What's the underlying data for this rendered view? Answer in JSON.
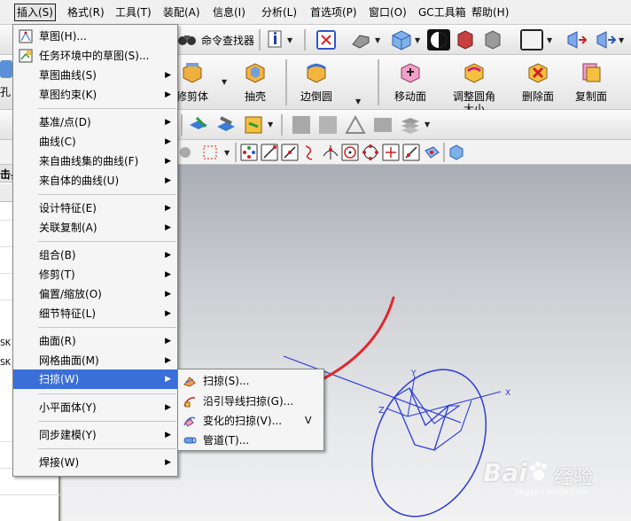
{
  "menubar": {
    "items": [
      {
        "label": "插入(S)",
        "active": true
      },
      {
        "label": "格式(R)"
      },
      {
        "label": "工具(T)"
      },
      {
        "label": "装配(A)"
      },
      {
        "label": "信息(I)"
      },
      {
        "label": "分析(L)"
      },
      {
        "label": "首选项(P)"
      },
      {
        "label": "窗口(O)"
      },
      {
        "label": "GC工具箱"
      },
      {
        "label": "帮助(H)"
      }
    ]
  },
  "toolbar": {
    "command_finder": "命令查找器",
    "left_cut_label": "孔",
    "buttons": [
      {
        "label": "修剪体"
      },
      {
        "label": "抽壳"
      },
      {
        "label": "边倒圆"
      },
      {
        "label": "移动面"
      },
      {
        "label": "调整圆角",
        "label2": "大小"
      },
      {
        "label": "删除面"
      },
      {
        "label": "复制面"
      }
    ]
  },
  "left_panel": {
    "header_cut": "击县",
    "row1": "SK",
    "row2": "SK"
  },
  "insert_menu": {
    "items": [
      {
        "label": "草图(H)...",
        "arrow": ""
      },
      {
        "label": "任务环境中的草图(S)...",
        "arrow": ""
      },
      {
        "label": "草图曲线(S)",
        "arrow": "▶"
      },
      {
        "label": "草图约束(K)",
        "arrow": "▶"
      },
      {
        "label": "基准/点(D)",
        "arrow": "▶"
      },
      {
        "label": "曲线(C)",
        "arrow": "▶"
      },
      {
        "label": "来自曲线集的曲线(F)",
        "arrow": "▶"
      },
      {
        "label": "来自体的曲线(U)",
        "arrow": "▶"
      },
      {
        "label": "设计特征(E)",
        "arrow": "▶"
      },
      {
        "label": "关联复制(A)",
        "arrow": "▶"
      },
      {
        "label": "组合(B)",
        "arrow": "▶"
      },
      {
        "label": "修剪(T)",
        "arrow": "▶"
      },
      {
        "label": "偏置/缩放(O)",
        "arrow": "▶"
      },
      {
        "label": "细节特征(L)",
        "arrow": "▶"
      },
      {
        "label": "曲面(R)",
        "arrow": "▶"
      },
      {
        "label": "网格曲面(M)",
        "arrow": "▶"
      },
      {
        "label": "扫掠(W)",
        "arrow": "▶"
      },
      {
        "label": "小平面体(Y)",
        "arrow": "▶"
      },
      {
        "label": "同步建模(Y)",
        "arrow": "▶"
      },
      {
        "label": "焊接(W)",
        "arrow": "▶"
      }
    ]
  },
  "sweep_submenu": {
    "items": [
      {
        "label": "扫掠(S)...",
        "shortcut": ""
      },
      {
        "label": "沿引导线扫掠(G)...",
        "shortcut": ""
      },
      {
        "label": "变化的扫掠(V)...",
        "shortcut": "V"
      },
      {
        "label": "管道(T)...",
        "shortcut": ""
      }
    ]
  },
  "viewport": {
    "axis_z": "Z",
    "axis_y": "Y",
    "axis_x": "X",
    "annotation_color": "#e0282a",
    "geometry_color": "#2a3bd8"
  },
  "watermark": {
    "brand": "Bai",
    "brand_suffix": "经验",
    "sub": "jingyan.baidu.com"
  },
  "colors": {
    "highlight": "#3a6ed8",
    "menu_bg": "#f5f5f5"
  }
}
